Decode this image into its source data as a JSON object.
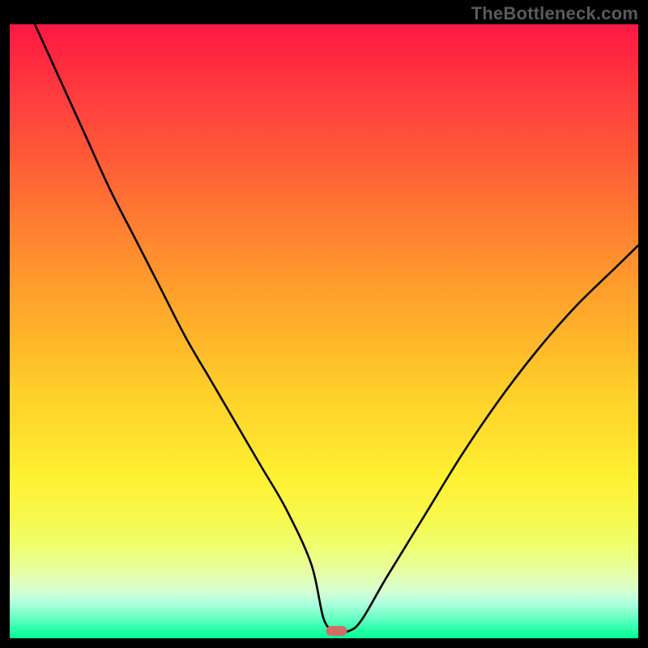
{
  "watermark": "TheBottleneck.com",
  "chart_data": {
    "type": "line",
    "title": "",
    "xlabel": "",
    "ylabel": "",
    "xlim": [
      0,
      100
    ],
    "ylim": [
      0,
      100
    ],
    "grid": false,
    "legend_position": "none",
    "background": "vertical traffic-light gradient (red→orange→yellow→green)",
    "annotations": [
      {
        "type": "marker",
        "shape": "rounded-rect",
        "x": 52,
        "y": 1.2,
        "color": "#d46a6a"
      }
    ],
    "series": [
      {
        "name": "bottleneck-curve",
        "color": "#000000",
        "x": [
          4,
          8,
          12,
          16,
          20,
          24,
          28,
          32,
          36,
          40,
          44,
          48,
          50,
          52,
          54,
          56,
          60,
          66,
          72,
          78,
          84,
          90,
          96,
          100
        ],
        "values": [
          100,
          91,
          82,
          73,
          65,
          57,
          49,
          42,
          35,
          28,
          21,
          12,
          3,
          1.2,
          1.2,
          3,
          10,
          20,
          30,
          39,
          47,
          54,
          60,
          64
        ]
      }
    ]
  }
}
